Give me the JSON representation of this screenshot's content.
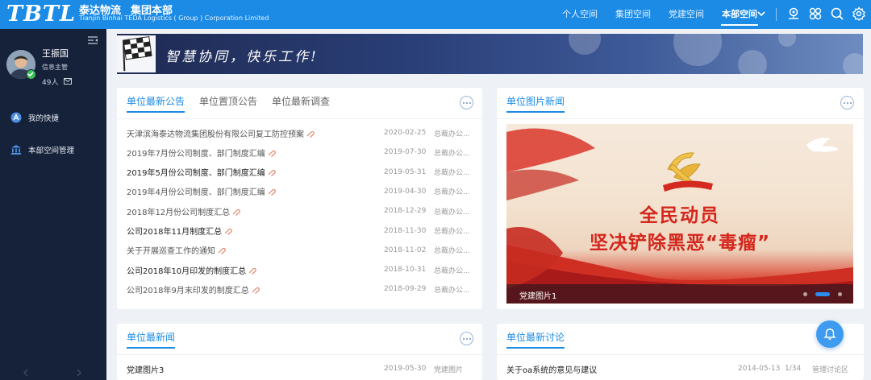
{
  "header": {
    "logo_text": "TBTL",
    "org_cn": [
      "泰达物流",
      "集团本部"
    ],
    "org_en": "Tianjin Binhai TEDA Logistics ( Group ) Corporation Limited",
    "nav": [
      "个人空间",
      "集团空间",
      "党建空间",
      "本部空间"
    ],
    "active_nav": "本部空间",
    "icons": [
      "chevron-down-icon",
      "location-icon",
      "grid-icon",
      "search-icon",
      "gear-icon"
    ]
  },
  "user": {
    "name": "王振国",
    "role": "信息主管",
    "count": "49人"
  },
  "sidebar": {
    "items": [
      {
        "label": "我的快捷",
        "icon": "shortcut-icon"
      },
      {
        "label": "本部空间管理",
        "icon": "bank-icon"
      }
    ]
  },
  "banner": {
    "text": "智慧协同，快乐工作!"
  },
  "notice_card": {
    "tabs": [
      "单位最新公告",
      "单位置顶公告",
      "单位最新调查"
    ],
    "rows": [
      {
        "title": "天津滨海泰达物流集团股份有限公司复工防控预案",
        "date": "2020-02-25",
        "dept": "总裁办公...",
        "bold": false
      },
      {
        "title": "2019年7月份公司制度、部门制度汇编",
        "date": "2019-07-30",
        "dept": "总裁办公...",
        "bold": false
      },
      {
        "title": "2019年5月份公司制度、部门制度汇编",
        "date": "2019-05-31",
        "dept": "总裁办公...",
        "bold": true
      },
      {
        "title": "2019年4月份公司制度、部门制度汇编",
        "date": "2019-04-30",
        "dept": "总裁办公...",
        "bold": false
      },
      {
        "title": "2018年12月份公司制度汇总",
        "date": "2018-12-29",
        "dept": "总裁办公...",
        "bold": false
      },
      {
        "title": "公司2018年11月制度汇总",
        "date": "2018-11-30",
        "dept": "总裁办公...",
        "bold": true
      },
      {
        "title": "关于开展巡查工作的通知",
        "date": "2018-11-02",
        "dept": "总裁办公...",
        "bold": false
      },
      {
        "title": "公司2018年10月印发的制度汇总",
        "date": "2018-10-31",
        "dept": "总裁办公...",
        "bold": true
      },
      {
        "title": "公司2018年9月末印发的制度汇总",
        "date": "2018-09-29",
        "dept": "总裁办公...",
        "bold": false
      }
    ]
  },
  "photo_card": {
    "tab": "单位图片新闻",
    "headline_1": "全民动员",
    "headline_2": "坚决铲除黑恶“毒瘤”",
    "caption": "党建图片1",
    "slide_count": 3,
    "active_slide": 2
  },
  "news_card": {
    "tab": "单位最新闻",
    "rows": [
      {
        "title": "党建图片3",
        "date": "2019-05-30",
        "dept": "党建图片"
      }
    ]
  },
  "discussion_card": {
    "tab": "单位最新讨论",
    "rows": [
      {
        "title": "关于oa系统的意见与建议",
        "date": "2014-05-13",
        "count": "1/34",
        "dept": "管理讨论区"
      }
    ]
  }
}
